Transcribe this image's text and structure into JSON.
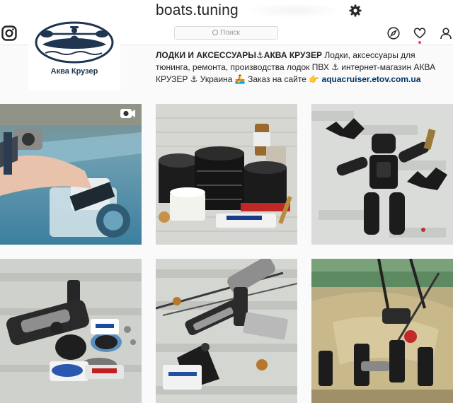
{
  "header": {
    "username": "boats.tuning"
  },
  "nav": {
    "search_placeholder": "Поиск",
    "icons": [
      "instagram-logo-icon",
      "explore-compass-icon",
      "heart-icon",
      "profile-icon",
      "gear-icon"
    ]
  },
  "logo": {
    "caption": "Аква Крузер"
  },
  "bio": {
    "name": "ЛОДКИ И АКСЕССУАРЫ⚓АКВА КРУЗЕР",
    "text": " Лодки, аксессуары для тюнинга, ремонта, производства лодок ПВХ ⚓ интернет-магазин АКВА КРУЗЕР ⚓ Украина 🚣 Заказ на сайте 👉 ",
    "link": "aquacruiser.etov.com.ua"
  },
  "grid": {
    "posts": [
      {
        "kind": "video",
        "subject": "camera-on-boat"
      },
      {
        "kind": "photo",
        "subject": "pvc-tapes-and-glue"
      },
      {
        "kind": "photo",
        "subject": "rubber-parts-robot"
      },
      {
        "kind": "photo",
        "subject": "rod-holder-kit"
      },
      {
        "kind": "photo",
        "subject": "rod-holder-mounts"
      },
      {
        "kind": "photo",
        "subject": "kayak-rod-holders"
      }
    ]
  },
  "colors": {
    "accent": "#003569",
    "notification_dot": "#ed4956",
    "logo_navy": "#1f3550"
  }
}
